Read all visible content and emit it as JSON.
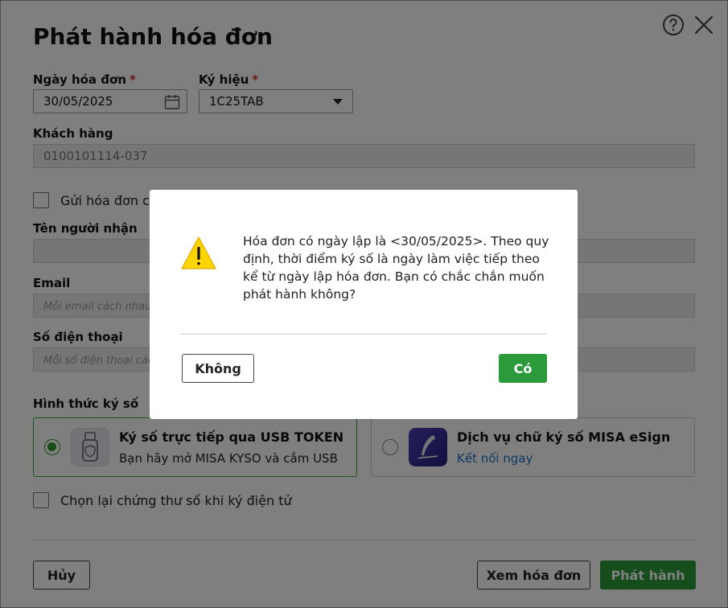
{
  "dialog": {
    "title": "Phát hành hóa đơn",
    "fields": {
      "invoice_date": {
        "label": "Ngày hóa đơn",
        "value": "30/05/2025"
      },
      "symbol": {
        "label": "Ký hiệu",
        "value": "1C25TAB"
      },
      "customer": {
        "label": "Khách hàng",
        "value": "0100101114-037"
      },
      "send_invoice_label": "Gửi hóa đơn ch",
      "recipient": {
        "label": "Tên người nhận"
      },
      "email": {
        "label": "Email",
        "placeholder": "Mỗi email cách nhau"
      },
      "phone": {
        "label": "Số điện thoại",
        "placeholder": "Mỗi số điện thoại các"
      }
    },
    "signing": {
      "label": "Hình thức ký số",
      "usb": {
        "title": "Ký số trực tiếp qua USB TOKEN",
        "subtitle": "Bạn hãy mở MISA KYSO và cắm USB"
      },
      "esign": {
        "title": "Dịch vụ chữ ký số MISA eSign",
        "link": "Kết nối ngay"
      }
    },
    "reselect_cert_label": "Chọn lại chứng thư số khi ký điện tử",
    "buttons": {
      "cancel": "Hủy",
      "view": "Xem hóa đơn",
      "issue": "Phát hành"
    }
  },
  "modal": {
    "message": "Hóa đơn có ngày lập là <30/05/2025>. Theo quy định, thời điểm ký số là ngày làm việc tiếp theo kể từ ngày lập hóa đơn. Bạn có chắc chắn muốn phát hành không?",
    "no_label": "Không",
    "yes_label": "Có"
  },
  "colors": {
    "primary_green": "#2b9a3a",
    "link_blue": "#1a73c9",
    "required_red": "#d52a2a"
  }
}
